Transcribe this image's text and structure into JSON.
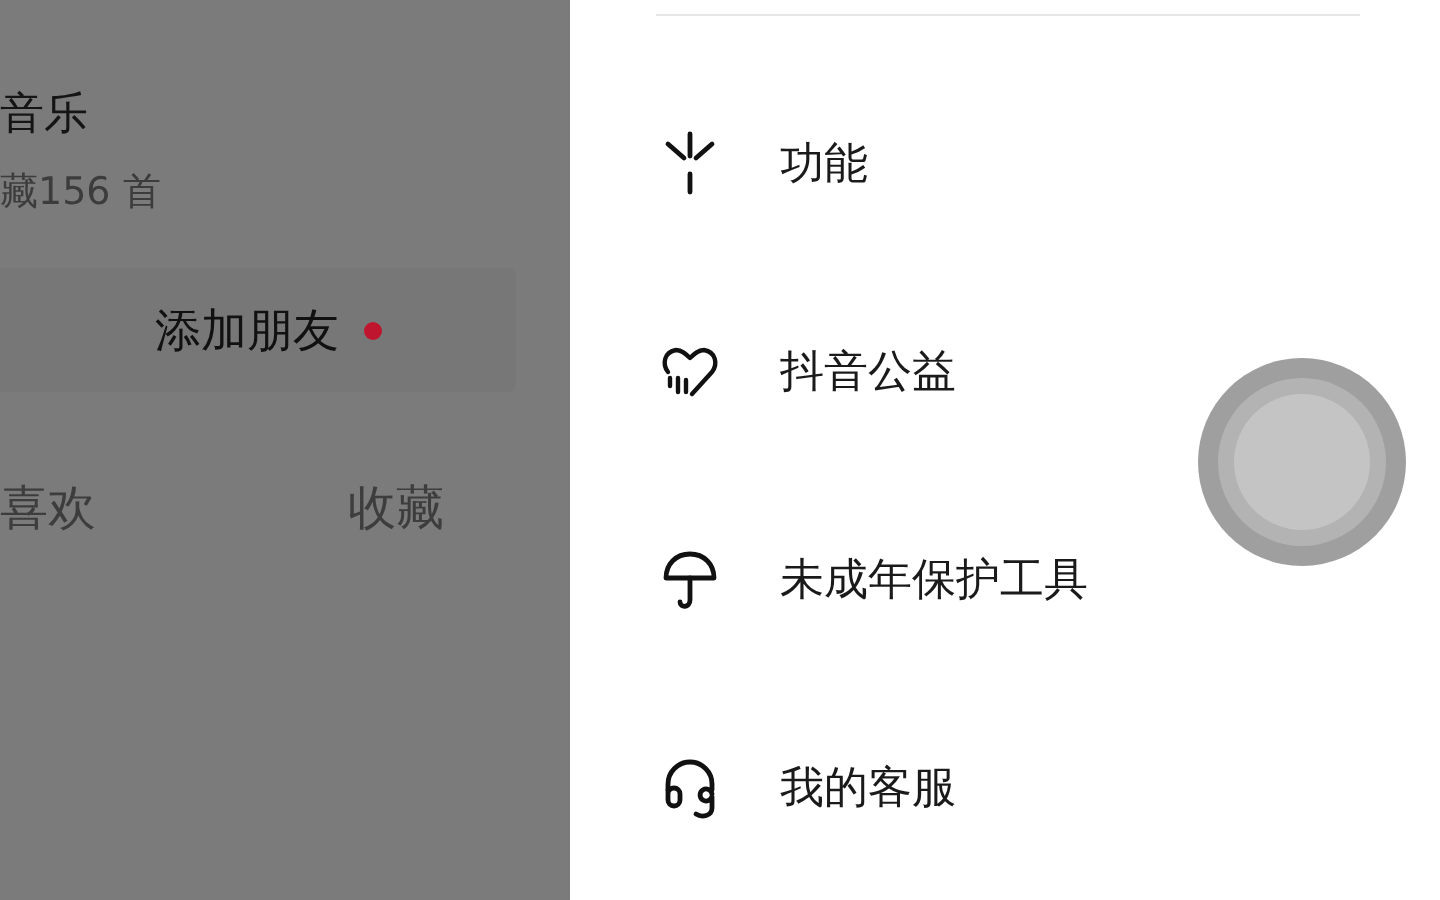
{
  "profile": {
    "title": "音乐",
    "subtitle": "藏156 首",
    "add_friend": {
      "label": "添加朋友",
      "new": true
    },
    "tabs": [
      {
        "label": "喜欢",
        "selected": false
      },
      {
        "label": "收藏",
        "selected": false
      }
    ]
  },
  "menu": [
    {
      "kind": "feature",
      "label": "功能"
    },
    {
      "kind": "charity",
      "label": "抖音公益"
    },
    {
      "kind": "minor",
      "label": "未成年保护工具"
    },
    {
      "kind": "service",
      "label": "我的客服"
    }
  ]
}
